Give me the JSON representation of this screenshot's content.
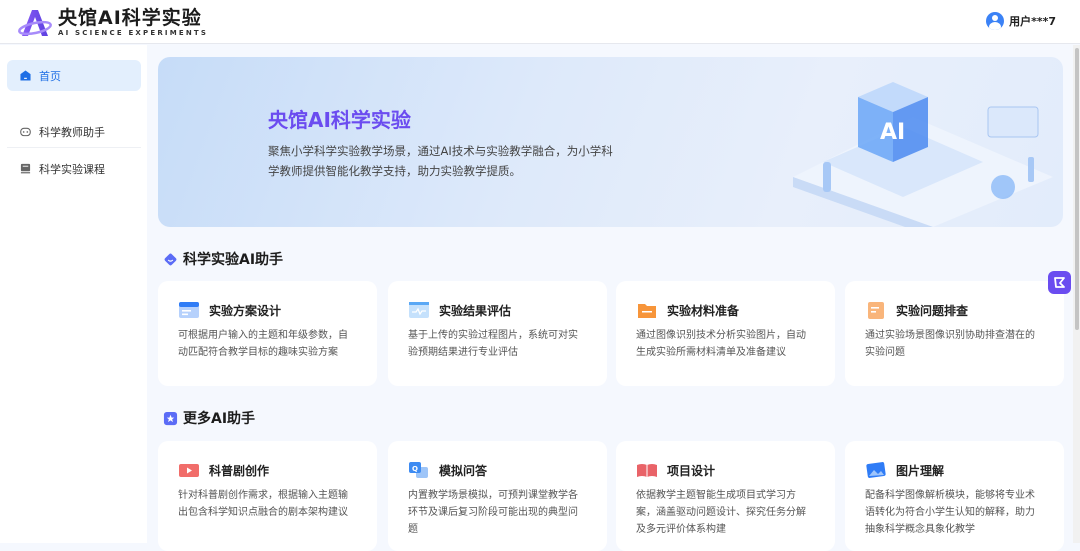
{
  "header": {
    "logo_title": "央馆AI科学实验",
    "logo_subtitle": "AI SCIENCE EXPERIMENTS",
    "user_name": "用户***7"
  },
  "sidebar": {
    "items": [
      {
        "label": "首页",
        "icon": "home-icon",
        "active": true
      },
      {
        "label": "科学教师助手",
        "icon": "robot-icon"
      },
      {
        "label": "科学实验课程",
        "icon": "monitor-icon"
      }
    ]
  },
  "banner": {
    "title": "央馆AI科学实验",
    "description": "聚焦小学科学实验教学场景，通过AI技术与实验教学融合，为小学科学教师提供智能化教学支持，助力实验教学提质。",
    "illustration_text": "AI"
  },
  "sections": [
    {
      "title": "科学实验AI助手",
      "cards": [
        {
          "title": "实验方案设计",
          "desc": "可根据用户输入的主题和年级参数，自动匹配符合教学目标的趣味实验方案",
          "icon": "plan-icon",
          "color": "#2f7cf6"
        },
        {
          "title": "实验结果评估",
          "desc": "基于上传的实验过程图片，系统可对实验预期结果进行专业评估",
          "icon": "chart-pulse-icon",
          "color": "#5aa8f5"
        },
        {
          "title": "实验材料准备",
          "desc": "通过图像识别技术分析实验图片，自动生成实验所需材料清单及准备建议",
          "icon": "folder-icon",
          "color": "#f7953a"
        },
        {
          "title": "实验问题排查",
          "desc": "通过实验场景图像识别协助排查潜在的实验问题",
          "icon": "document-icon",
          "color": "#f7a25a"
        }
      ]
    },
    {
      "title": "更多AI助手",
      "cards": [
        {
          "title": "科普剧创作",
          "desc": "针对科普剧创作需求，根据输入主题输出包含科学知识点融合的剧本架构建议",
          "icon": "video-icon",
          "color": "#ef5350"
        },
        {
          "title": "模拟问答",
          "desc": "内置教学场景模拟，可预判课堂教学各环节及课后复习阶段可能出现的典型问题",
          "icon": "qa-icon",
          "color": "#3d8bf2"
        },
        {
          "title": "项目设计",
          "desc": "依据教学主题智能生成项目式学习方案，涵盖驱动问题设计、探究任务分解及多元评价体系构建",
          "icon": "book-icon",
          "color": "#e5484d"
        },
        {
          "title": "图片理解",
          "desc": "配备科学图像解析模块，能够将专业术语转化为符合小学生认知的解释，助力抽象科学概念具象化教学",
          "icon": "image-icon",
          "color": "#2f7cf6"
        }
      ]
    }
  ]
}
